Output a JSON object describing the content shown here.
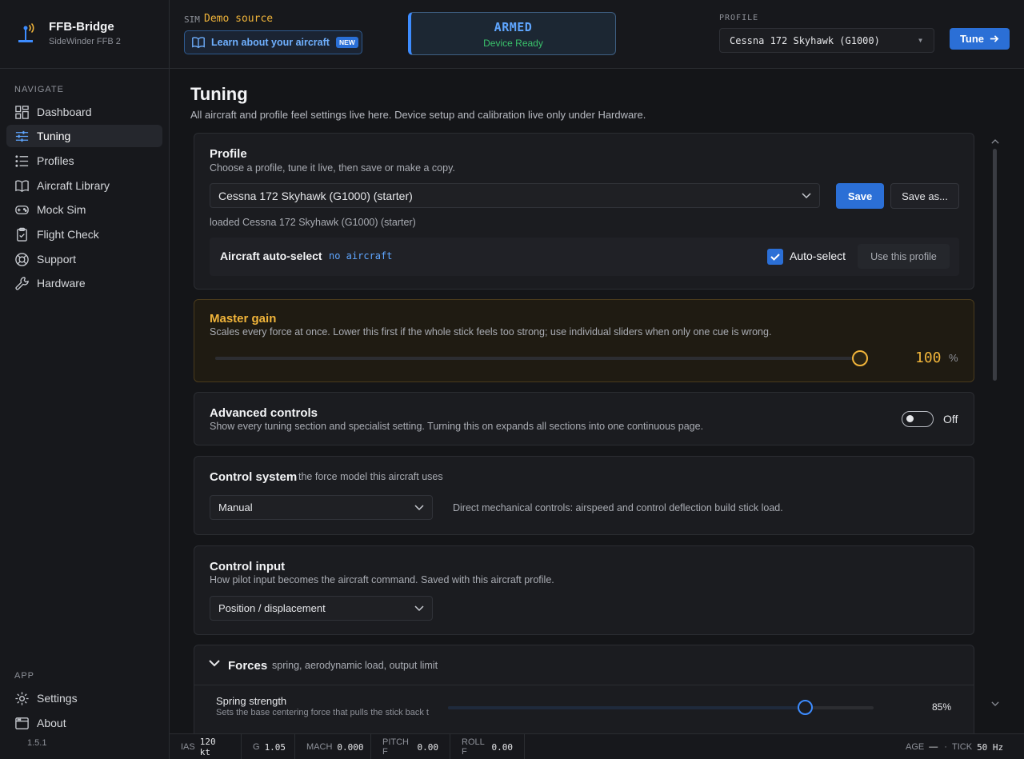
{
  "app": {
    "name": "FFB-Bridge",
    "device": "SideWinder FFB 2",
    "version": "1.5.1"
  },
  "sidebar": {
    "navigate_heading": "NAVIGATE",
    "items": [
      {
        "label": "Dashboard",
        "icon": "dashboard-icon"
      },
      {
        "label": "Tuning",
        "icon": "sliders-icon",
        "active": true
      },
      {
        "label": "Profiles",
        "icon": "list-icon"
      },
      {
        "label": "Aircraft Library",
        "icon": "book-icon"
      },
      {
        "label": "Mock Sim",
        "icon": "gamepad-icon"
      },
      {
        "label": "Flight Check",
        "icon": "clipboard-check-icon"
      },
      {
        "label": "Support",
        "icon": "lifebuoy-icon"
      },
      {
        "label": "Hardware",
        "icon": "wrench-icon"
      }
    ],
    "app_heading": "APP",
    "app_items": [
      {
        "label": "Settings",
        "icon": "gear-icon"
      },
      {
        "label": "About",
        "icon": "window-icon"
      }
    ]
  },
  "topbar": {
    "sim_label": "SIM",
    "sim_value": "Demo source",
    "learn_label": "Learn about your aircraft",
    "new_badge": "NEW",
    "status_title": "ARMED",
    "status_sub": "Device Ready",
    "profile_label": "PROFILE",
    "profile_value": "Cessna 172 Skyhawk (G1000)",
    "tune_label": "Tune"
  },
  "page": {
    "title": "Tuning",
    "subtitle": "All aircraft and profile feel settings live here. Device setup and calibration live only under Hardware."
  },
  "profile_card": {
    "title": "Profile",
    "subtitle": "Choose a profile, tune it live, then save or make a copy.",
    "selected": "Cessna 172 Skyhawk (G1000) (starter)",
    "save_label": "Save",
    "save_as_label": "Save as...",
    "loaded_text": "loaded Cessna 172 Skyhawk (G1000) (starter)",
    "auto_select_label": "Aircraft auto-select",
    "auto_select_value": "no aircraft",
    "auto_select_checkbox_label": "Auto-select",
    "auto_select_checked": true,
    "use_profile_label": "Use this profile"
  },
  "master_gain": {
    "title": "Master gain",
    "subtitle": "Scales every force at once. Lower this first if the whole stick feels too strong; use individual sliders when only one cue is wrong.",
    "value": "100",
    "unit": "%",
    "fraction": 1.0,
    "color": "#f0b43a"
  },
  "advanced": {
    "title": "Advanced controls",
    "subtitle": "Show every tuning section and specialist setting. Turning this on expands all sections into one continuous page.",
    "state_label": "Off",
    "enabled": false
  },
  "control_system": {
    "title": "Control system",
    "hint": "the force model this aircraft uses",
    "selected": "Manual",
    "description": "Direct mechanical controls: airspeed and control deflection build stick load."
  },
  "control_input": {
    "title": "Control input",
    "subtitle": "How pilot input becomes the aircraft command. Saved with this aircraft profile.",
    "selected": "Position / displacement"
  },
  "forces": {
    "title": "Forces",
    "hint": "spring, aerodynamic load, output limit",
    "spring_label": "Spring strength",
    "spring_desc": "Sets the base centering force that pulls the stick back t",
    "spring_value": "85%",
    "spring_fraction": 0.84,
    "color": "#3d8cff"
  },
  "statusbar": {
    "ias_label": "IAS",
    "ias_value": "120 kt",
    "g_label": "G",
    "g_value": "1.05",
    "mach_label": "MACH",
    "mach_value": "0.000",
    "pitch_label": "PITCH F",
    "pitch_value": "0.00",
    "roll_label": "ROLL F",
    "roll_value": "0.00",
    "age_label": "AGE",
    "age_value": "—",
    "dot": "·",
    "tick_label": "TICK",
    "tick_value": "50 Hz"
  }
}
